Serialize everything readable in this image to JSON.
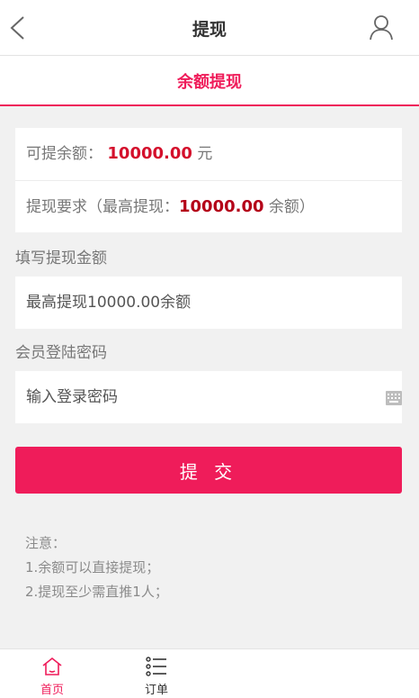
{
  "header": {
    "title": "提现",
    "back_icon": "chevron-left-icon",
    "user_icon": "user-icon"
  },
  "tabs": [
    {
      "label": "余额提现",
      "active": true
    }
  ],
  "balance": {
    "label": "可提余额：",
    "amount": "10000.00",
    "unit": "元"
  },
  "requirement": {
    "prefix": "提现要求（最高提现：",
    "amount": "10000.00",
    "suffix": "余额）"
  },
  "amount_section": {
    "label": "填写提现金额",
    "placeholder": "最高提现10000.00余额",
    "value": ""
  },
  "password_section": {
    "label": "会员登陆密码",
    "placeholder": "输入登录密码",
    "value": "",
    "keyboard_icon": "keyboard-icon"
  },
  "submit_label": "提 交",
  "notes": {
    "title": "注意：",
    "items": [
      "1.余额可以直接提现；",
      "2.提现至少需直推1人；"
    ]
  },
  "bottom_nav": [
    {
      "label": "首页",
      "icon": "home-icon",
      "active": true
    },
    {
      "label": "订单",
      "icon": "list-icon",
      "active": false
    }
  ],
  "colors": {
    "accent": "#ef1c5a",
    "amount_red": "#d4102c",
    "background": "#f1f1f1"
  }
}
